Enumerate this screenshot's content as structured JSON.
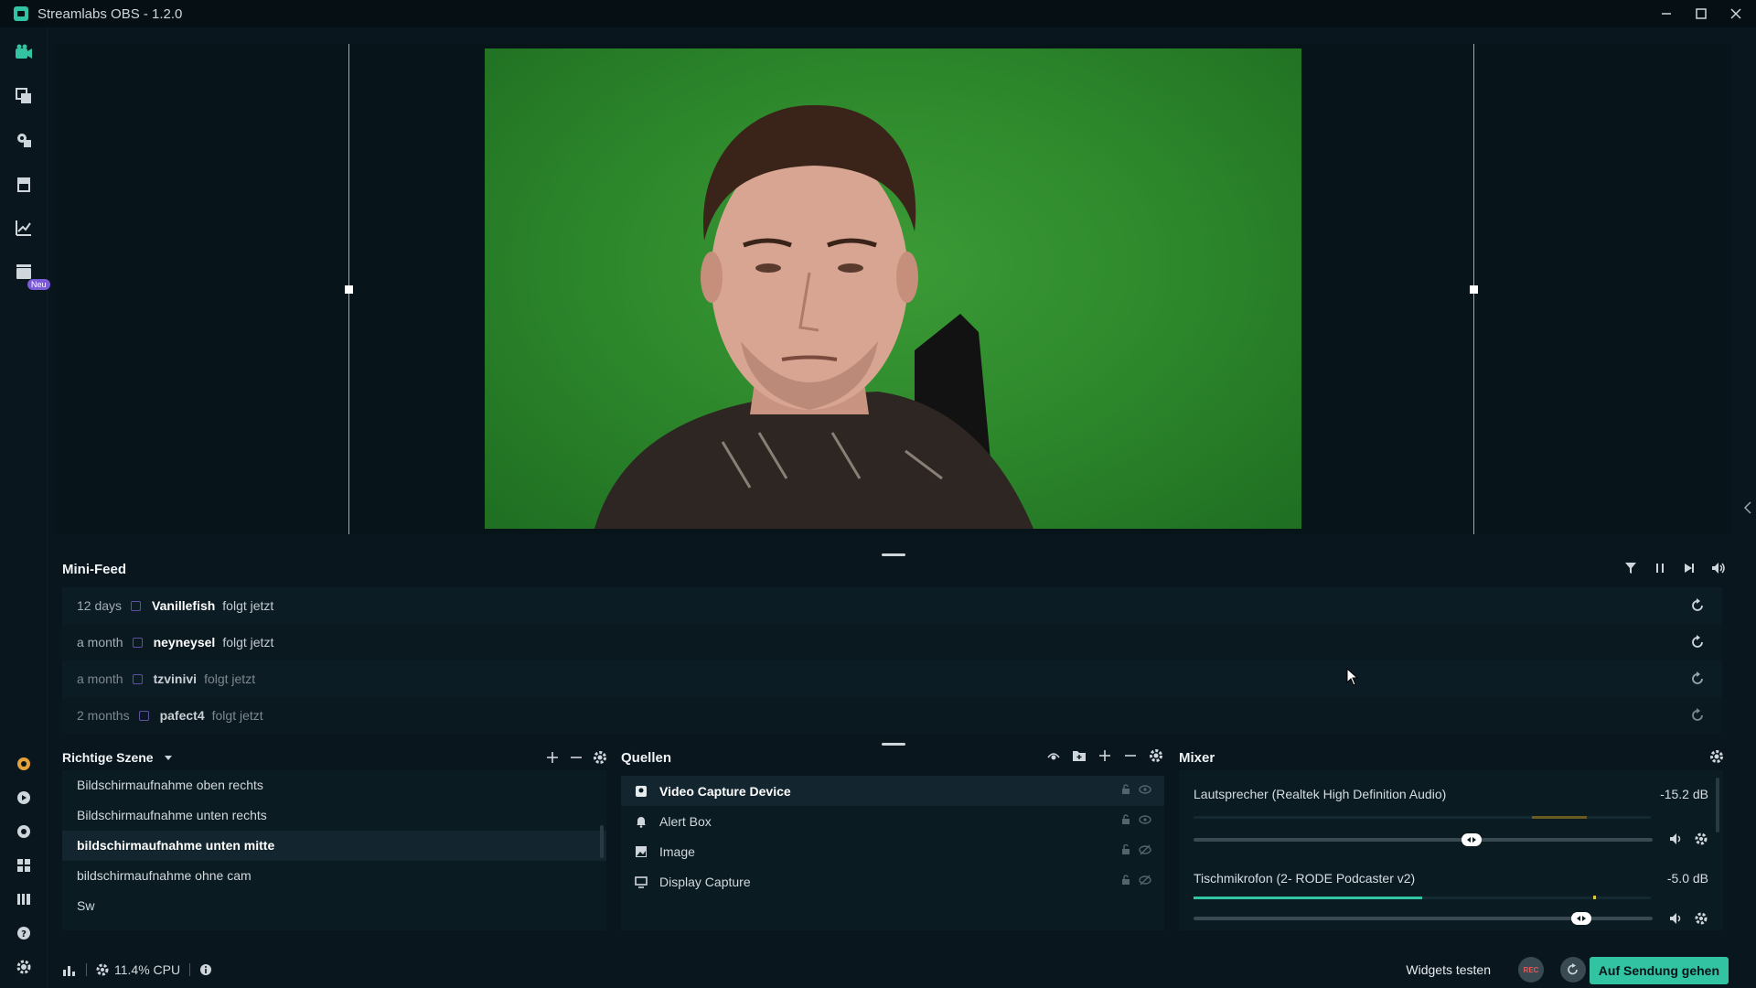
{
  "window": {
    "title": "Streamlabs OBS - 1.2.0"
  },
  "sidebar": {
    "new_badge": "Neu"
  },
  "mini_feed": {
    "title": "Mini-Feed",
    "events": [
      {
        "time": "12 days",
        "name": "Vanillefish",
        "action": "folgt jetzt"
      },
      {
        "time": "a month",
        "name": "neyneysel",
        "action": "folgt jetzt"
      },
      {
        "time": "a month",
        "name": "tzvinivi",
        "action": "folgt jetzt"
      },
      {
        "time": "2 months",
        "name": "pafect4",
        "action": "folgt jetzt"
      }
    ]
  },
  "scenes": {
    "title": "Richtige Szene",
    "items": [
      "Bildschirmaufnahme oben rechts",
      "Bildschirmaufnahme unten rechts",
      "bildschirmaufnahme unten mitte",
      "bildschirmaufnahme ohne cam",
      "Sw"
    ],
    "active_index": 2
  },
  "sources": {
    "title": "Quellen",
    "items": [
      {
        "label": "Video Capture Device",
        "icon": "camera-icon"
      },
      {
        "label": "Alert Box",
        "icon": "bell-icon"
      },
      {
        "label": "Image",
        "icon": "image-icon"
      },
      {
        "label": "Display Capture",
        "icon": "monitor-icon"
      }
    ],
    "active_index": 0
  },
  "mixer": {
    "title": "Mixer",
    "channels": [
      {
        "name": "Lautsprecher (Realtek High Definition Audio)",
        "db": "-15.2 dB",
        "volume": 0.61,
        "level": 0.0
      },
      {
        "name": "Tischmikrofon (2- RODE Podcaster v2)",
        "db": "-5.0 dB",
        "volume": 0.86,
        "level": 0.5
      }
    ]
  },
  "footer": {
    "cpu": "11.4% CPU",
    "widgets_test": "Widgets testen",
    "rec": "REC",
    "go_live": "Auf Sendung gehen"
  },
  "colors": {
    "accent": "#31c3a2",
    "background": "#09161d",
    "panel": "#0b1b22",
    "twitch": "#5d4fa3"
  }
}
